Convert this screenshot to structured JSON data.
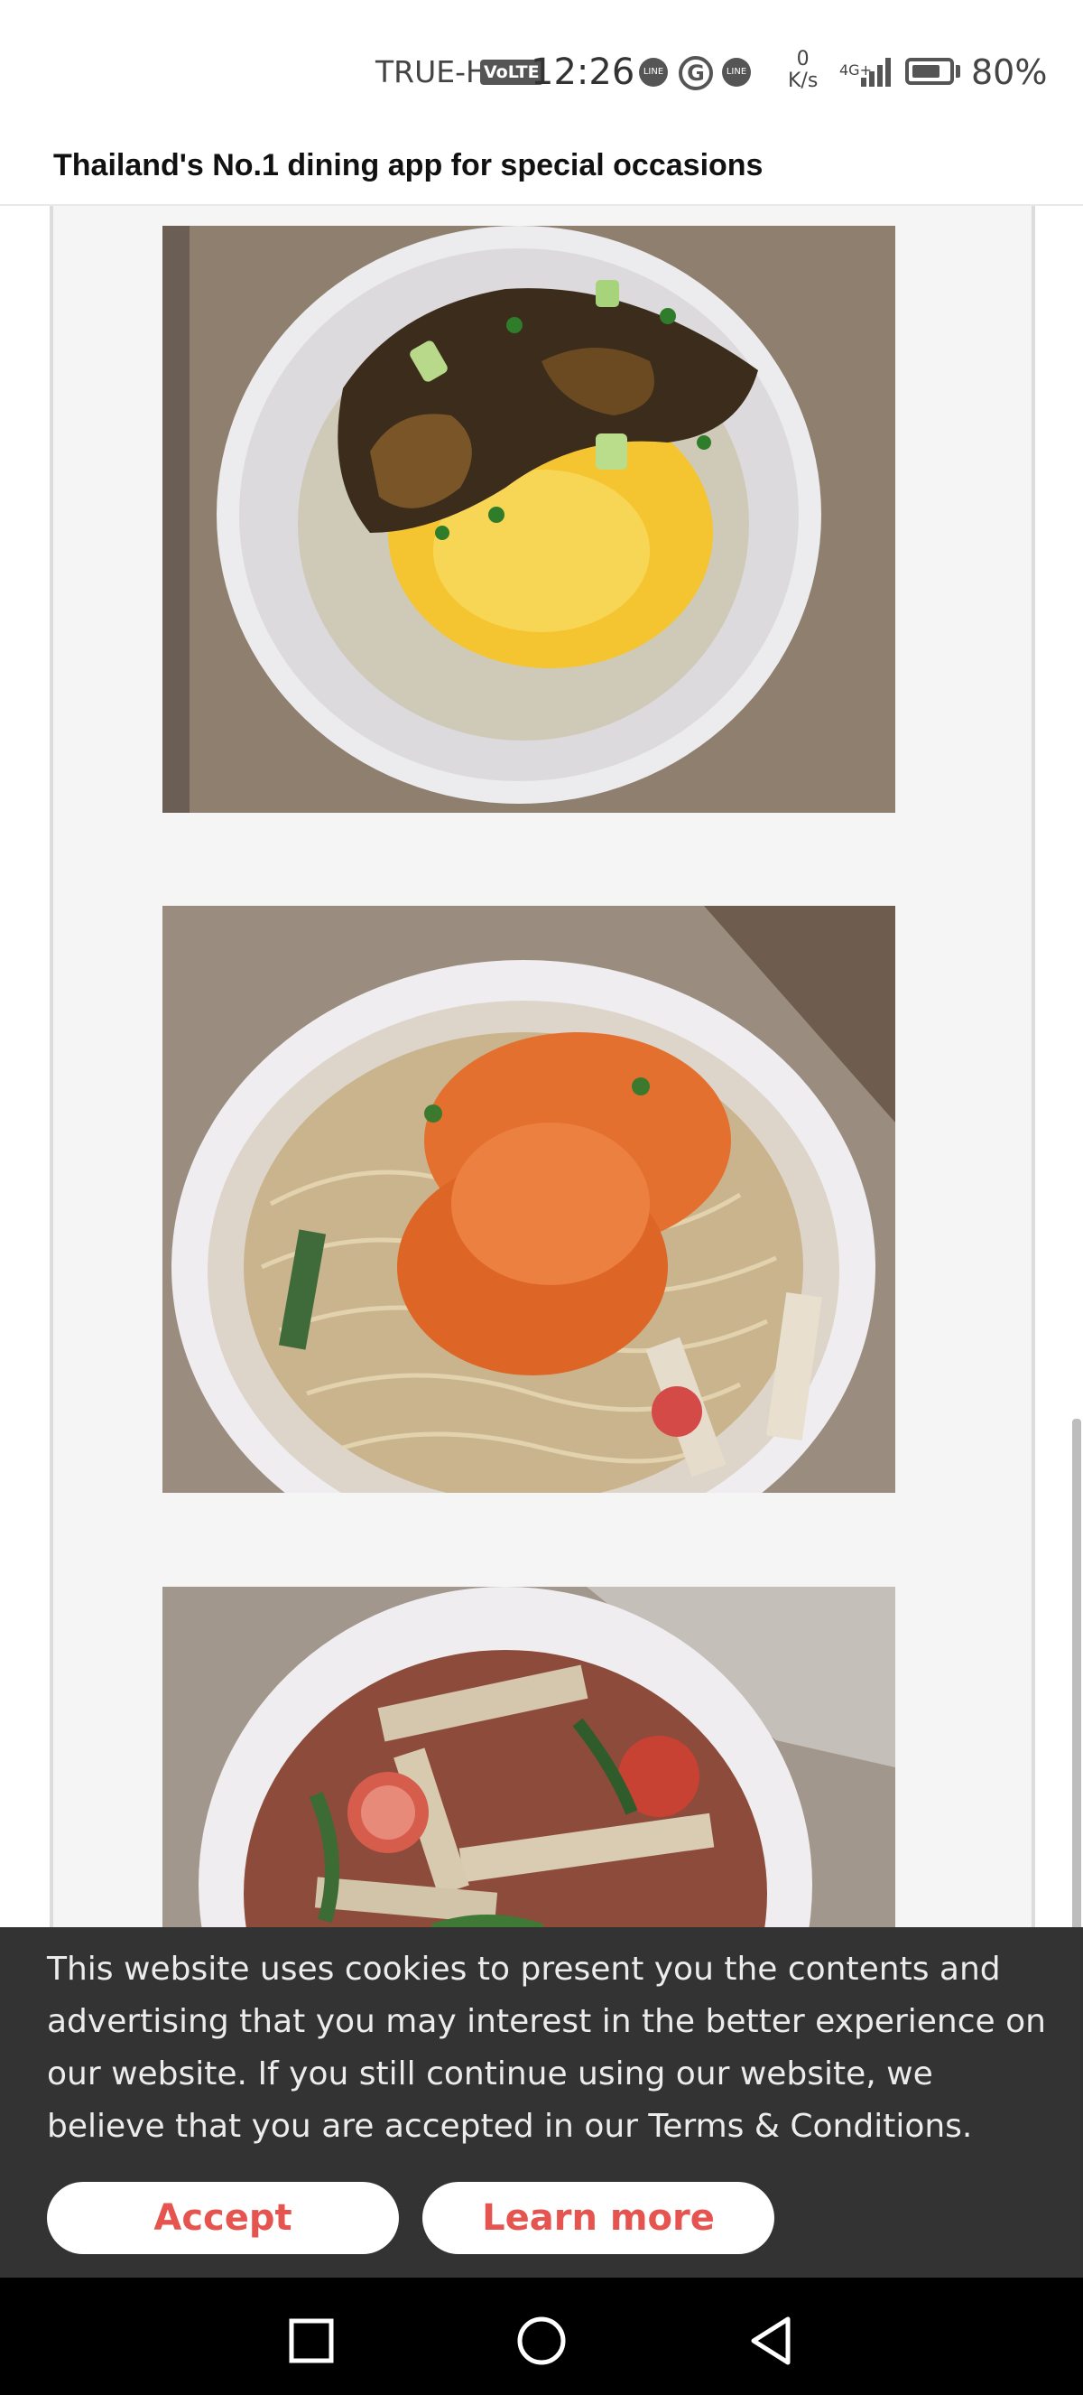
{
  "status_bar": {
    "carrier": "TRUE-H",
    "volte": "VoLTE",
    "time": "12:26",
    "line_icon_text": "LINE",
    "speed_value": "0",
    "speed_unit": "K/s",
    "network": "4G+",
    "battery": "80%",
    "battery_level": 0.8
  },
  "header": {
    "title": "Thailand's No.1 dining app for special occasions"
  },
  "cookie_banner": {
    "message": "This website uses cookies to present you the contents and advertising that you may interest in the better experience on our website. If you still continue using our website, we believe that you are accepted in our Terms & Conditions.",
    "accept_label": "Accept",
    "learn_more_label": "Learn more",
    "button_text_color": "#e5544f"
  },
  "colors": {
    "banner_bg": "#333333",
    "nav_bg": "#000000"
  }
}
